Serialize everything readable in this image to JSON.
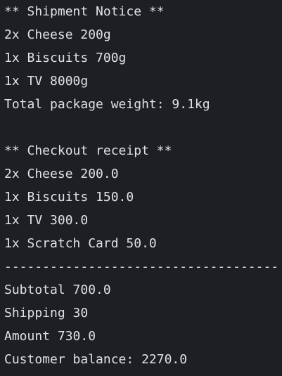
{
  "theme": {
    "background": "#1e1f22",
    "foreground": "#dfe1e5"
  },
  "shipment": {
    "header": "** Shipment Notice **",
    "items": [
      "2x Cheese 200g",
      "1x Biscuits 700g",
      "1x TV 8000g"
    ],
    "total_weight": "Total package weight: 9.1kg"
  },
  "receipt": {
    "header": "** Checkout receipt **",
    "items": [
      "2x Cheese 200.0",
      "1x Biscuits 150.0",
      "1x TV 300.0",
      "1x Scratch Card 50.0"
    ],
    "divider": "------------------------------------",
    "subtotal": "Subtotal 700.0",
    "shipping": "Shipping 30",
    "amount": "Amount 730.0",
    "customer_balance": "Customer balance: 2270.0"
  }
}
